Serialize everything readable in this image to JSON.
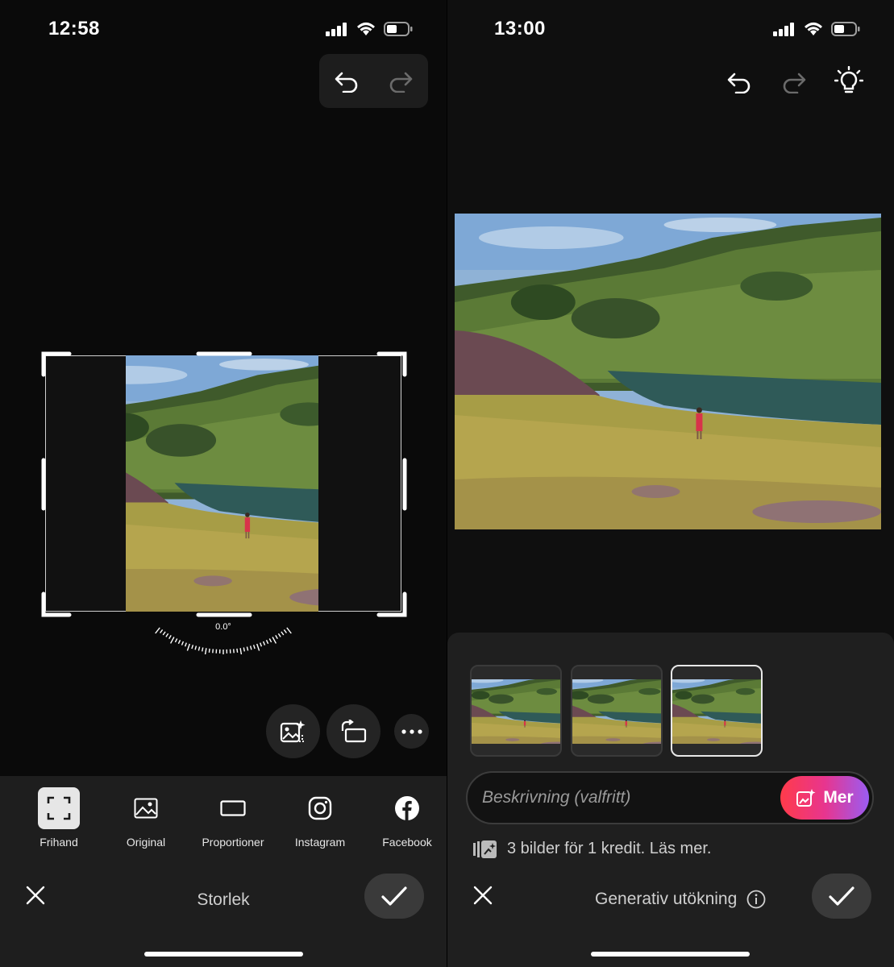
{
  "left": {
    "status_bar": {
      "time": "12:58"
    },
    "toolbar_top": {
      "undo": "undo",
      "redo": "redo"
    },
    "crop": {
      "angle_label": "0.0°"
    },
    "floating_actions": [
      "generative-expand-icon",
      "rotate-icon",
      "more-icon"
    ],
    "options": [
      {
        "label": "Frihand",
        "icon": "freehand-crop-icon",
        "selected": true
      },
      {
        "label": "Original",
        "icon": "image-icon",
        "selected": false
      },
      {
        "label": "Proportioner",
        "icon": "aspect-ratio-icon",
        "selected": false
      },
      {
        "label": "Instagram",
        "icon": "instagram-icon",
        "selected": false
      },
      {
        "label": "Facebook",
        "icon": "facebook-icon",
        "selected": false
      }
    ],
    "bottom_bar": {
      "title": "Storlek"
    }
  },
  "right": {
    "status_bar": {
      "time": "13:00"
    },
    "variations": {
      "count": 3,
      "selected_index": 2
    },
    "description": {
      "placeholder": "Beskrivning (valfritt)",
      "value": ""
    },
    "more_button": {
      "label": "Mer"
    },
    "credit_info": {
      "text": "3 bilder för 1 kredit. Läs mer."
    },
    "bottom_bar": {
      "title": "Generativ utökning"
    }
  },
  "colors": {
    "accent_gradient_start": "#ff3b4a",
    "accent_gradient_mid": "#e8358e",
    "accent_gradient_end": "#9a5cf2",
    "toolbar_bg": "#1e1e1e",
    "selected_option_bg": "#e6e6e6"
  }
}
